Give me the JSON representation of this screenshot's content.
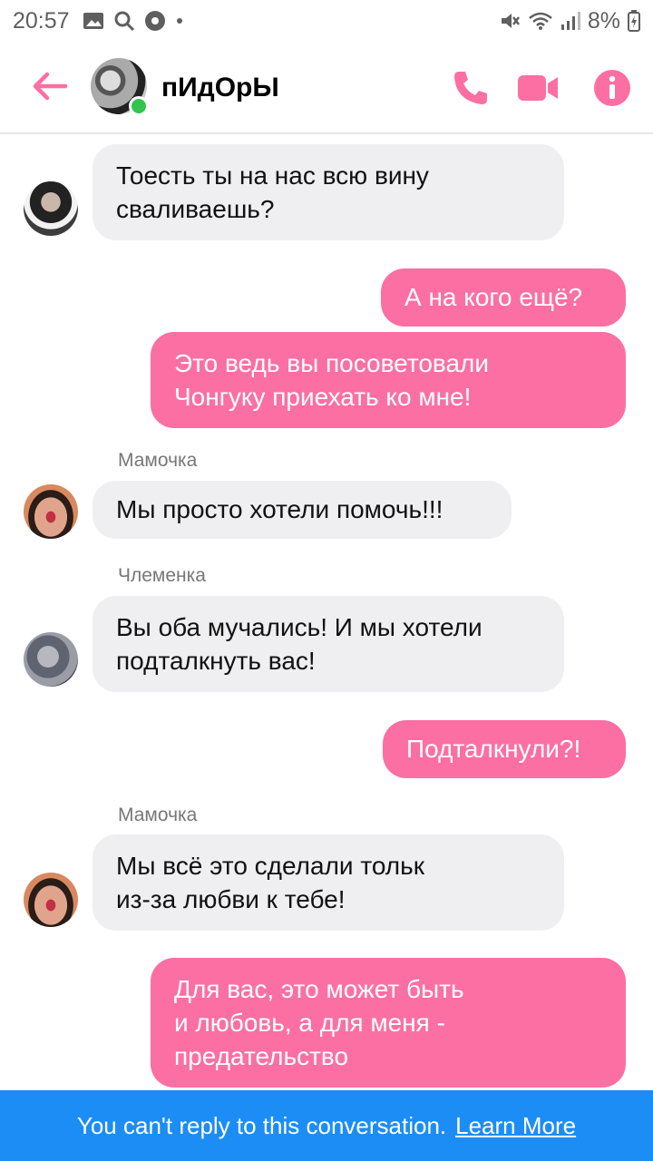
{
  "status_bar": {
    "time": "20:57",
    "battery": "8%",
    "icons_left": [
      "gallery-icon",
      "search-icon",
      "music-icon",
      "dot-icon"
    ],
    "icons_right": [
      "mute-icon",
      "wifi-icon",
      "signal-icon",
      "battery-icon"
    ]
  },
  "header": {
    "title": "пИдОрЫ",
    "online": true,
    "accent_color": "#fc6fa3"
  },
  "messages": [
    {
      "direction": "in",
      "sender": "",
      "lines": [
        "Тоесть ты на нас всю вину",
        "сваливаешь?"
      ]
    },
    {
      "direction": "out",
      "lines": [
        "А на кого ещё?"
      ]
    },
    {
      "direction": "out",
      "lines": [
        "Это ведь вы посоветовали",
        "Чонгуку приехать ко мне!"
      ]
    },
    {
      "direction": "in",
      "sender": "Мамочка",
      "lines": [
        "Мы просто хотели помочь!!!"
      ]
    },
    {
      "direction": "in",
      "sender": "Члеменка",
      "lines": [
        "Вы оба мучались! И мы хотели",
        "подталкнуть вас!"
      ]
    },
    {
      "direction": "out",
      "lines": [
        "Подталкнули?!"
      ]
    },
    {
      "direction": "in",
      "sender": "Мамочка",
      "lines": [
        "Мы всё это сделали тольк",
        "из-за любви к тебе!"
      ]
    },
    {
      "direction": "out",
      "lines": [
        "Для вас, это может быть",
        "и любовь, а для меня -",
        "предательство"
      ]
    }
  ],
  "footer": {
    "notice": "You can't reply to this conversation.",
    "link": "Learn More",
    "bar_color": "#1b8df5"
  }
}
